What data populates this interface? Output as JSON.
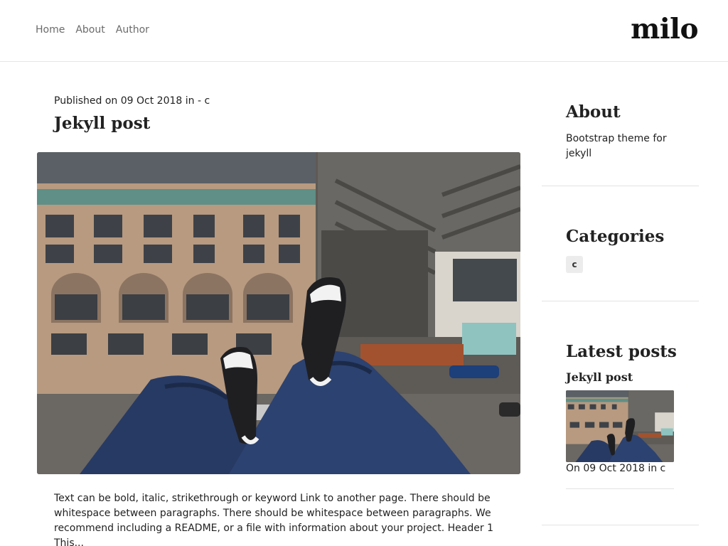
{
  "header": {
    "nav": [
      "Home",
      "About",
      "Author"
    ],
    "brand": "milo"
  },
  "post": {
    "meta": "Published on 09 Oct 2018 in - c",
    "title": "Jekyll post",
    "image_alt": "Photo of a person's legs in jeans and sneakers dangling over a city street from a rooftop",
    "excerpt": "Text can be bold, italic, strikethrough or keyword Link to another page. There should be whitespace between paragraphs. There should be whitespace between paragraphs. We recommend including a README, or a file with information about your project. Header 1 This..."
  },
  "sidebar": {
    "about": {
      "heading": "About",
      "text": "Bootstrap theme for jekyll"
    },
    "categories": {
      "heading": "Categories",
      "items": [
        "c"
      ]
    },
    "latest": {
      "heading": "Latest posts",
      "items": [
        {
          "title": "Jekyll post",
          "meta": "On 09 Oct 2018 in c"
        }
      ]
    }
  }
}
